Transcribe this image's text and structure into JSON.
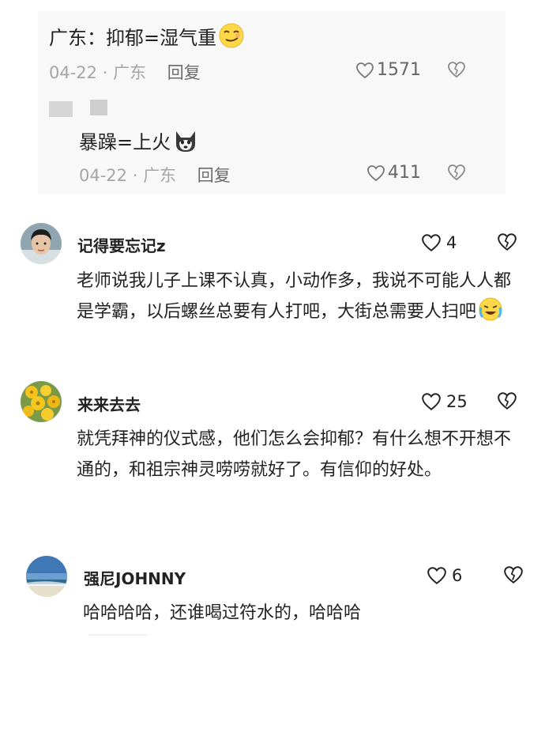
{
  "quote": {
    "main": {
      "text": "广东：抑郁=湿气重",
      "emoji": "smirking-face-emoji",
      "date": "04-22",
      "location": "广东",
      "reply_label": "回复",
      "likes": "1571"
    },
    "reply": {
      "text": "暴躁=上火",
      "emoji": "husky-dog-emoji",
      "date": "04-22",
      "location": "广东",
      "reply_label": "回复",
      "likes": "411"
    }
  },
  "comments": [
    {
      "username": "记得要忘记z",
      "likes": "4",
      "text": "老师说我儿子上课不认真，小动作多，我说不可能人人都是学霸，以后螺丝总要有人打吧，大街总需要人扫吧",
      "emoji": "crying-laughing-emoji",
      "avatar": "person-photo-avatar"
    },
    {
      "username": "来来去去",
      "likes": "25",
      "text": "就凭拜神的仪式感，他们怎么会抑郁？有什么想不开想不通的，和祖宗神灵唠唠就好了。有信仰的好处。",
      "avatar": "yellow-flowers-avatar"
    },
    {
      "username": "强尼JOHNNY",
      "likes": "6",
      "text": "哈哈哈哈，还谁喝过符水的，哈哈哈",
      "avatar": "beach-sky-avatar"
    }
  ],
  "colors": {
    "quote_bg": "#f8f8f8",
    "meta_gray": "#a6a6a6",
    "text": "#222222"
  }
}
